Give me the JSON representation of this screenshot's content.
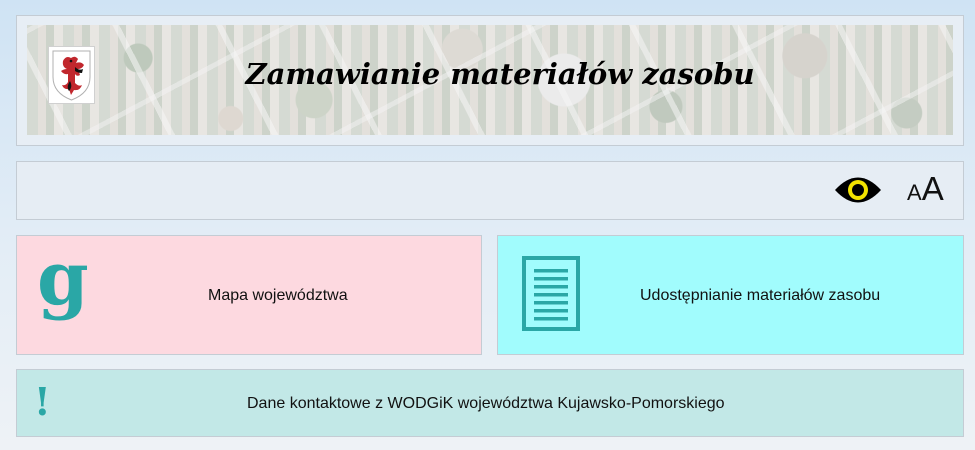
{
  "header": {
    "title": "Zamawianie materiałów zasobu",
    "logo_icon": "coat-of-arms-griffin-icon"
  },
  "toolbar": {
    "contrast_icon": "eye-icon",
    "font_size_small": "A",
    "font_size_large": "A"
  },
  "tiles": {
    "map": {
      "label": "Mapa województwa",
      "icon": "g-letter-icon",
      "background": "#fdd9e0"
    },
    "share": {
      "label": "Udostępnianie materiałów zasobu",
      "icon": "document-icon",
      "background": "#a1fcfd"
    },
    "contact": {
      "label": "Dane kontaktowe z WODGiK województwa Kujawsko-Pomorskiego",
      "icon": "exclamation-icon",
      "background": "#c2e8e7"
    }
  },
  "colors": {
    "accent": "#2aa7a6"
  }
}
